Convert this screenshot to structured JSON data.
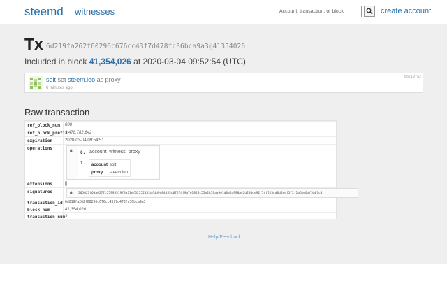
{
  "header": {
    "logo": "steemd",
    "nav_witnesses": "witnesses",
    "search_placeholder": "Account, transaction, or block",
    "create_account": "create account"
  },
  "tx": {
    "title": "Tx",
    "hash": "6d219fa262f60296c676cc43f7d478fc36bca9a3",
    "hash_sep": "@",
    "hash_block": "41354026",
    "included_prefix": "Included in block",
    "block": "41,354,026",
    "included_at": "at 2020-03-04 09:52:54 (UTC)"
  },
  "op_card": {
    "user": "solt",
    "action": "set",
    "target": "steem.leo",
    "suffix": "as proxy",
    "time": "6 minutes ago",
    "id": "6d219fa2"
  },
  "raw": {
    "title": "Raw transaction",
    "rows": {
      "ref_block_num": {
        "key": "ref_block_num",
        "value": "808"
      },
      "ref_block_prefix": {
        "key": "ref_block_prefix",
        "value": "3,478,782,842"
      },
      "expiration": {
        "key": "expiration",
        "value": "2020-03-04 09:54:51"
      },
      "operations": {
        "key": "operations"
      },
      "extensions": {
        "key": "extensions",
        "value": "[]"
      },
      "signatures": {
        "key": "signatures"
      },
      "transaction_id": {
        "key": "transaction_id",
        "value": "6d219fa262f60296c676cc43f7d478fc36bca9a3"
      },
      "block_num": {
        "key": "block_num",
        "value": "41,354,026"
      },
      "transaction_num": {
        "key": "transaction_num",
        "value": "3"
      }
    },
    "operations": {
      "index": "0.",
      "name_index": "0.",
      "name": "account_witness_proxy",
      "sub_index": "1.",
      "fields": [
        {
          "key": "account",
          "value": "solt"
        },
        {
          "key": "proxy",
          "value": "steem.leo"
        }
      ]
    },
    "signature": {
      "index": "0.",
      "value": "205627f60a0577c75993519f8a11ef62552432dfdd9e84d55c075f4f9a7e1826c55e2859aa9e1d0a6a998ac2d203de92f5ff523cd8d4eef5f2f1a6be0af5a07c3"
    }
  },
  "footer": {
    "help": "Help/Feedback"
  }
}
